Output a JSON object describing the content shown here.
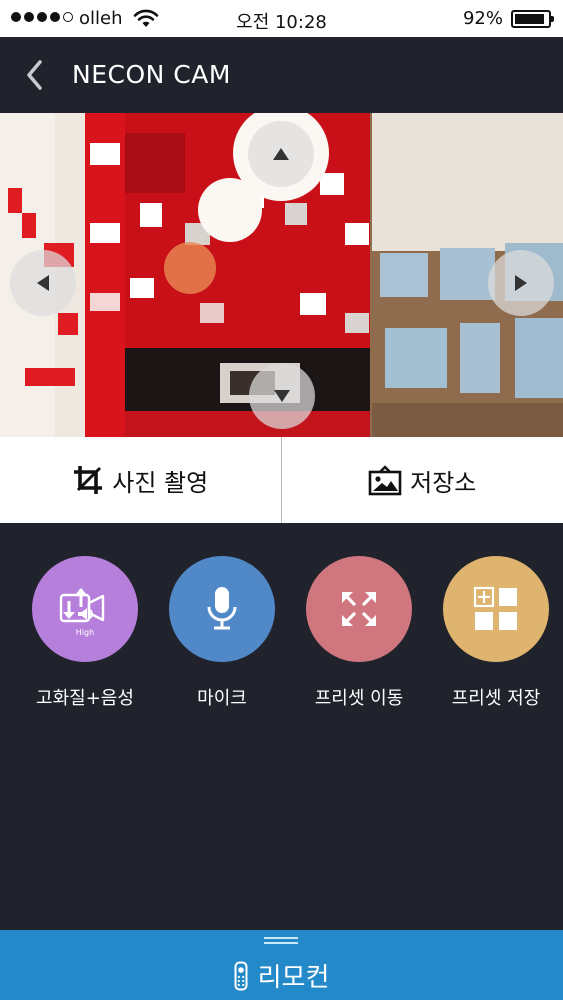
{
  "status_bar": {
    "carrier": "olleh",
    "time": "오전 10:28",
    "battery_percent_label": "92%",
    "battery_level": 0.92,
    "signal_bars_filled": 4,
    "signal_bars_total": 5,
    "icons": [
      "signal-dots-icon",
      "wifi-icon",
      "battery-icon"
    ]
  },
  "nav": {
    "back_icon": "chevron-left-icon",
    "title": "NECON CAM"
  },
  "camera": {
    "controls": [
      "arrow-up-icon",
      "arrow-down-icon",
      "arrow-left-icon",
      "arrow-right-icon"
    ]
  },
  "actions": {
    "snapshot_label": "사진 촬영",
    "snapshot_icon": "crop-icon",
    "storage_label": "저장소",
    "storage_icon": "gallery-icon"
  },
  "features": [
    {
      "label": "고화질+음성",
      "icon": "hd-video-audio-icon",
      "tag": "High",
      "color": "#b57fdb"
    },
    {
      "label": "마이크",
      "icon": "microphone-icon",
      "color": "#5088c8"
    },
    {
      "label": "프리셋 이동",
      "icon": "expand-arrows-icon",
      "color": "#d0767e"
    },
    {
      "label": "프리셋 저장",
      "icon": "grid-add-icon",
      "color": "#dfb46e"
    }
  ],
  "remote": {
    "label": "리모컨",
    "icon": "remote-control-icon",
    "handle_icon": "drag-handle-icon"
  },
  "colors": {
    "background": "#20232c",
    "remote_bar": "#2489c9",
    "action_row": "#ffffff"
  }
}
